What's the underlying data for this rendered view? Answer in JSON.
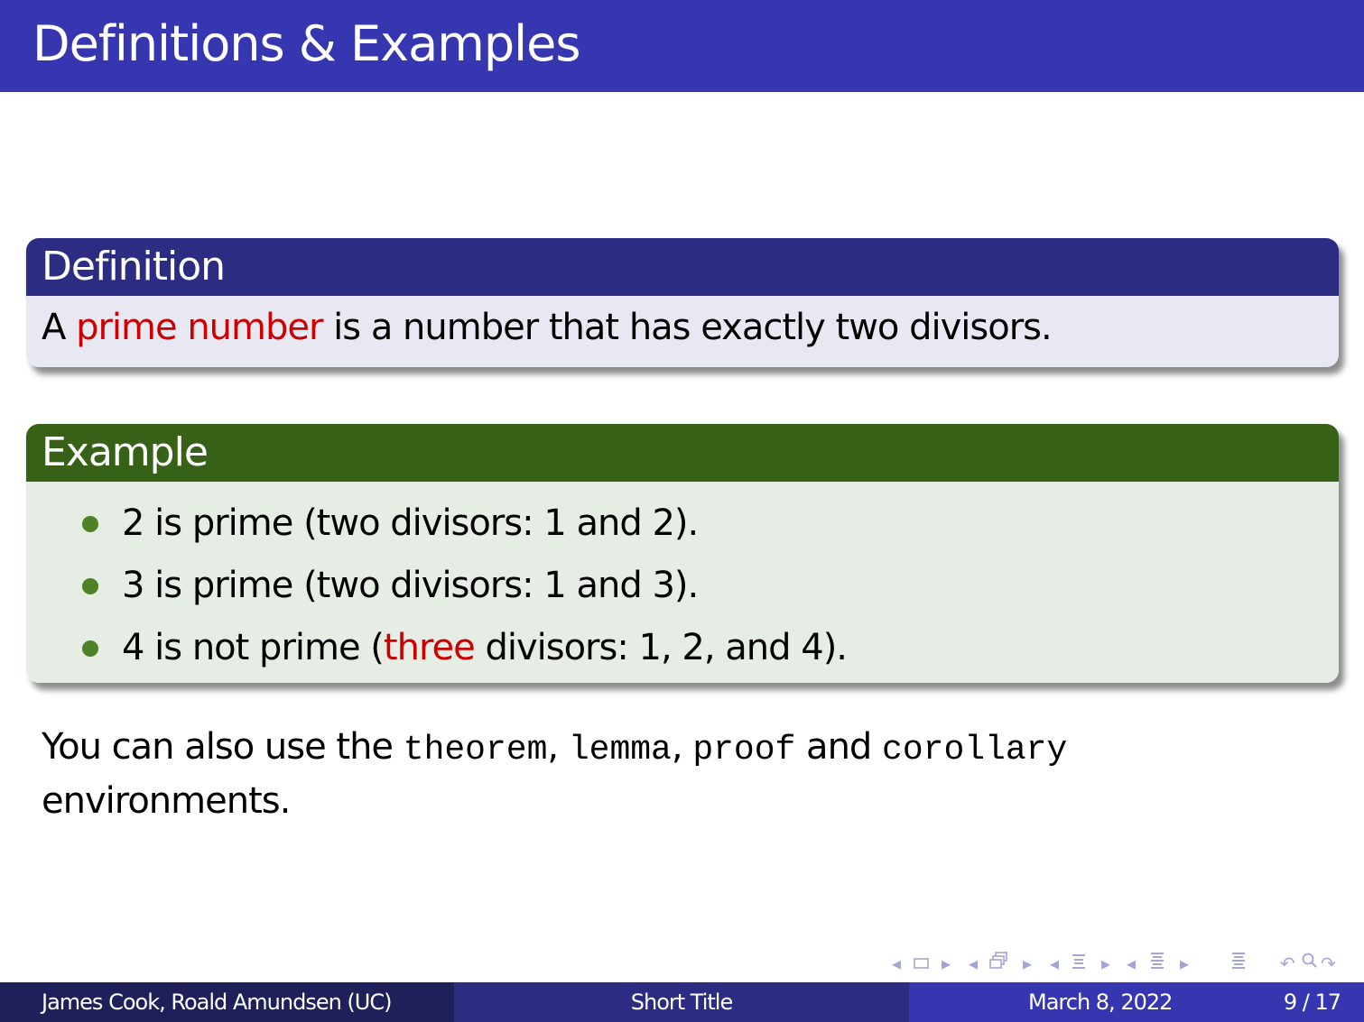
{
  "slide": {
    "title": "Definitions & Examples",
    "definition_block": {
      "title": "Definition",
      "body_parts": [
        "A ",
        "prime number",
        " is a number that has exactly two divisors."
      ]
    },
    "example_block": {
      "title": "Example",
      "items": [
        {
          "parts": [
            "2 is prime (two divisors: 1 and 2).",
            "",
            ""
          ]
        },
        {
          "parts": [
            "3 is prime (two divisors: 1 and 3).",
            "",
            ""
          ]
        },
        {
          "parts": [
            "4 is not prime (",
            "three",
            " divisors: 1, 2, and 4)."
          ]
        }
      ]
    },
    "note": {
      "prefix": "You can also use the ",
      "env1": "theorem",
      "sep1": ", ",
      "env2": "lemma",
      "sep2": ", ",
      "env3": "proof",
      "sep3": " and ",
      "env4": "corollary",
      "suffix": " environments."
    }
  },
  "navigation": {
    "icons": [
      "left-arrow",
      "frame-icon",
      "right-arrow",
      "left-arrow",
      "subsection-icon",
      "right-arrow",
      "left-arrow",
      "section-icon",
      "right-arrow",
      "left-arrow",
      "document-icon",
      "right-arrow",
      "toc-icon",
      "undo-icon",
      "search-icon",
      "redo-icon"
    ]
  },
  "footer": {
    "authors": "James Cook, Roald Amundsen  (UC)",
    "short_title": "Short Title",
    "date": "March 8, 2022",
    "page": "9 / 17"
  },
  "colors": {
    "title_bar": "#3636b0",
    "definition_header": "#2c2c82",
    "definition_body": "#e8e8f3",
    "example_header": "#376116",
    "example_body": "#e6ede4",
    "alert_text": "#cc0000",
    "bullet": "#4f8228"
  }
}
